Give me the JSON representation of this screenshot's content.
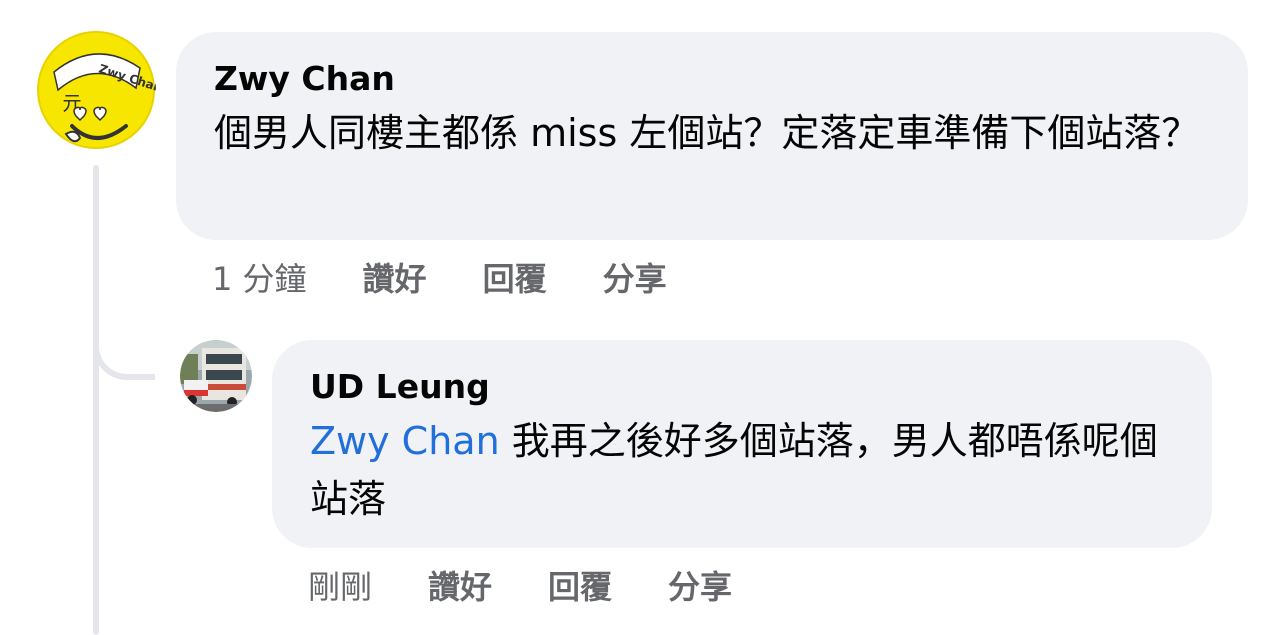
{
  "comments": [
    {
      "author": "Zwy Chan",
      "avatar_text": "Zwy Chan",
      "text": "個男人同樓主都係 miss 左個站？定落定車準備下個站落？",
      "time": "1 分鐘",
      "actions": {
        "like": "讚好",
        "reply": "回覆",
        "share": "分享"
      }
    },
    {
      "author": "UD Leung",
      "mention": "Zwy Chan",
      "text": " 我再之後好多個站落，男人都唔係呢個站落",
      "time": "剛剛",
      "actions": {
        "like": "讚好",
        "reply": "回覆",
        "share": "分享"
      }
    }
  ],
  "colors": {
    "bubble": "#f0f2f5",
    "mention": "#216fdb",
    "meta": "#65676b",
    "avatar_yellow": "#f7e600"
  }
}
